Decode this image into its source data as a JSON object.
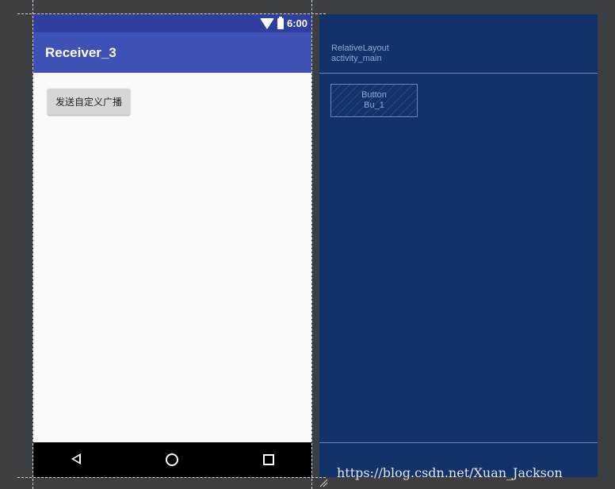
{
  "status_bar": {
    "time": "6:00",
    "icons": [
      "wifi-icon",
      "battery-icon"
    ]
  },
  "app_bar": {
    "title": "Receiver_3"
  },
  "content": {
    "send_button_label": "发送自定义广播"
  },
  "navigation_bar": {
    "icons": [
      "back-icon",
      "home-icon",
      "recents-icon"
    ]
  },
  "blueprint": {
    "layout_type": "RelativeLayout",
    "layout_id": "activity_main",
    "button_type": "Button",
    "button_id": "Bu_1"
  },
  "watermark": "https://blog.csdn.net/Xuan_Jackson",
  "colors": {
    "status_bar": "#303f9f",
    "app_bar": "#3f51b5",
    "blueprint_bg": "#133269",
    "workspace_bg": "#3c3f41"
  }
}
